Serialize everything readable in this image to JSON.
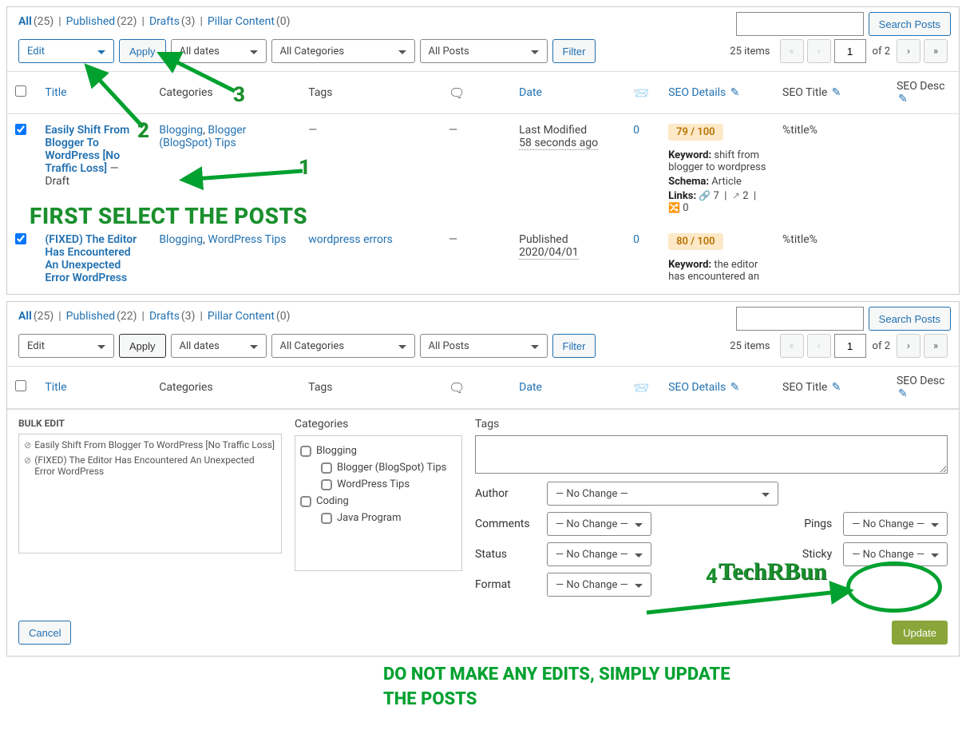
{
  "filters": {
    "all_label": "All",
    "all_count": "(25)",
    "published_label": "Published",
    "published_count": "(22)",
    "drafts_label": "Drafts",
    "drafts_count": "(3)",
    "pillar_label": "Pillar Content",
    "pillar_count": "(0)"
  },
  "search": {
    "button": "Search Posts"
  },
  "toolbar": {
    "bulk_action": "Edit",
    "apply": "Apply",
    "dates": "All dates",
    "categories": "All Categories",
    "posts": "All Posts",
    "filter": "Filter",
    "items": "25 items",
    "page": "1",
    "of": "of 2"
  },
  "columns": {
    "title": "Title",
    "categories": "Categories",
    "tags": "Tags",
    "date": "Date",
    "seo": "SEO Details",
    "seot": "SEO Title",
    "seod": "SEO Desc"
  },
  "rows": [
    {
      "checked": true,
      "title": "Easily Shift From Blogger To WordPress [No Traffic Loss]",
      "status": " — Draft",
      "categories_1": "Blogging",
      "categories_2": "Blogger (BlogSpot) Tips",
      "tags": "—",
      "comments": "—",
      "date_l1": "Last Modified",
      "date_l2": "58 seconds ago",
      "incoming": "0",
      "seo_score": "79 / 100",
      "seo_kw_label": "Keyword:",
      "seo_kw": "shift from blogger to wordpress",
      "seo_schema_label": "Schema:",
      "seo_schema": "Article",
      "seo_links_label": "Links:",
      "seo_links_int": "7",
      "seo_links_ext": "2",
      "seo_links_shuf": "0",
      "seot": "%title%"
    },
    {
      "checked": true,
      "title": "(FIXED) The Editor Has Encountered An Unexpected Error WordPress",
      "status": "",
      "categories_1": "Blogging",
      "categories_2": "WordPress Tips",
      "tags_link": "wordpress errors",
      "comments": "—",
      "date_l1": "Published",
      "date_l2": "2020/04/01",
      "incoming": "0",
      "seo_score": "80 / 100",
      "seo_kw_label": "Keyword:",
      "seo_kw": "the editor has encountered an",
      "seot": "%title%"
    }
  ],
  "ann": {
    "n1": "1",
    "n2": "2",
    "n3": "3",
    "n4": "4",
    "first": "FIRST SELECT THE POSTS",
    "brand": "TechRBun",
    "bottom1": "DO NOT MAKE ANY EDITS, SIMPLY UPDATE",
    "bottom2": "THE POSTS"
  },
  "bulk": {
    "heading": "BULK EDIT",
    "categories_h": "Categories",
    "tags_h": "Tags",
    "posts": [
      "Easily Shift From Blogger To WordPress [No Traffic Loss]",
      "(FIXED) The Editor Has Encountered An Unexpected Error WordPress"
    ],
    "cats": [
      "Blogging",
      "Blogger (BlogSpot) Tips",
      "WordPress Tips",
      "Coding",
      "Java Program"
    ],
    "fields": {
      "author": "Author",
      "comments": "Comments",
      "status": "Status",
      "format": "Format",
      "pings": "Pings",
      "sticky": "Sticky"
    },
    "nochange": "— No Change —",
    "cancel": "Cancel",
    "update": "Update"
  }
}
